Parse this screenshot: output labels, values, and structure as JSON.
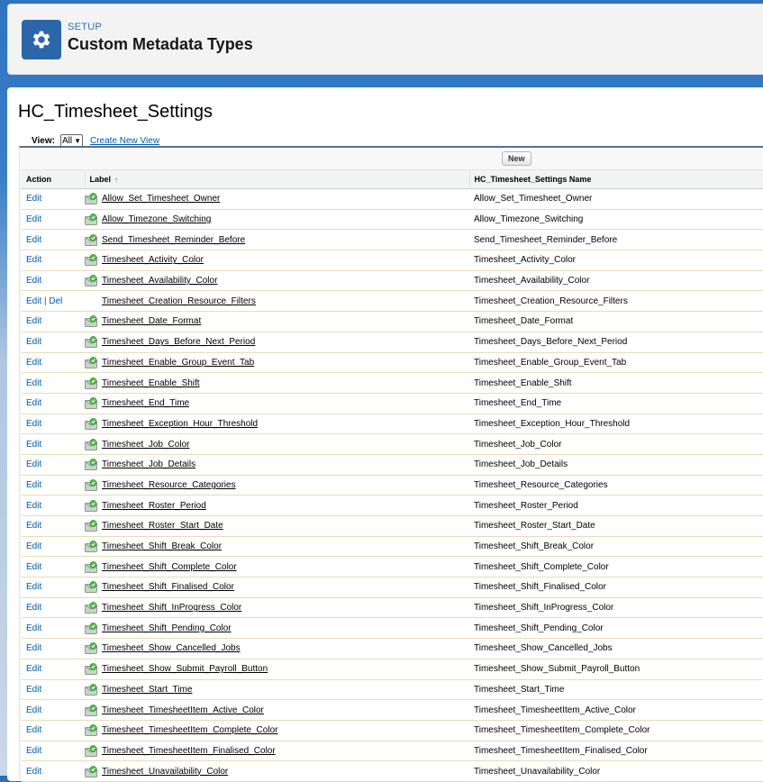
{
  "header": {
    "setup_label": "SETUP",
    "title": "Custom Metadata Types",
    "icon": "gear-icon"
  },
  "main": {
    "object_title": "HC_Timesheet_Settings",
    "view_label": "View:",
    "view_selected": "All",
    "create_view_link": "Create New View",
    "new_button": "New"
  },
  "table": {
    "columns": {
      "action": "Action",
      "label": "Label",
      "label_sort": "↑",
      "name": "HC_Timesheet_Settings Name"
    },
    "rows": [
      {
        "action": "Edit",
        "managed": true,
        "label": "Allow_Set_Timesheet_Owner",
        "name": "Allow_Set_Timesheet_Owner"
      },
      {
        "action": "Edit",
        "managed": true,
        "label": "Allow_Timezone_Switching",
        "name": "Allow_Timezone_Switching"
      },
      {
        "action": "Edit",
        "managed": true,
        "label": "Send_Timesheet_Reminder_Before",
        "name": "Send_Timesheet_Reminder_Before"
      },
      {
        "action": "Edit",
        "managed": true,
        "label": "Timesheet_Activity_Color",
        "name": "Timesheet_Activity_Color"
      },
      {
        "action": "Edit",
        "managed": true,
        "label": "Timesheet_Availability_Color",
        "name": "Timesheet_Availability_Color"
      },
      {
        "action": "Edit | Del",
        "managed": false,
        "label": "Timesheet_Creation_Resource_Filters",
        "name": "Timesheet_Creation_Resource_Filters"
      },
      {
        "action": "Edit",
        "managed": true,
        "label": "Timesheet_Date_Format",
        "name": "Timesheet_Date_Format"
      },
      {
        "action": "Edit",
        "managed": true,
        "label": "Timesheet_Days_Before_Next_Period",
        "name": "Timesheet_Days_Before_Next_Period"
      },
      {
        "action": "Edit",
        "managed": true,
        "label": "Timesheet_Enable_Group_Event_Tab",
        "name": "Timesheet_Enable_Group_Event_Tab"
      },
      {
        "action": "Edit",
        "managed": true,
        "label": "Timesheet_Enable_Shift",
        "name": "Timesheet_Enable_Shift"
      },
      {
        "action": "Edit",
        "managed": true,
        "label": "Timesheet_End_Time",
        "name": "Timesheet_End_Time"
      },
      {
        "action": "Edit",
        "managed": true,
        "label": "Timesheet_Exception_Hour_Threshold",
        "name": "Timesheet_Exception_Hour_Threshold"
      },
      {
        "action": "Edit",
        "managed": true,
        "label": "Timesheet_Job_Color",
        "name": "Timesheet_Job_Color"
      },
      {
        "action": "Edit",
        "managed": true,
        "label": "Timesheet_Job_Details",
        "name": "Timesheet_Job_Details"
      },
      {
        "action": "Edit",
        "managed": true,
        "label": "Timesheet_Resource_Categories",
        "name": "Timesheet_Resource_Categories"
      },
      {
        "action": "Edit",
        "managed": true,
        "label": "Timesheet_Roster_Period",
        "name": "Timesheet_Roster_Period"
      },
      {
        "action": "Edit",
        "managed": true,
        "label": "Timesheet_Roster_Start_Date",
        "name": "Timesheet_Roster_Start_Date"
      },
      {
        "action": "Edit",
        "managed": true,
        "label": "Timesheet_Shift_Break_Color",
        "name": "Timesheet_Shift_Break_Color"
      },
      {
        "action": "Edit",
        "managed": true,
        "label": "Timesheet_Shift_Complete_Color",
        "name": "Timesheet_Shift_Complete_Color"
      },
      {
        "action": "Edit",
        "managed": true,
        "label": "Timesheet_Shift_Finalised_Color",
        "name": "Timesheet_Shift_Finalised_Color"
      },
      {
        "action": "Edit",
        "managed": true,
        "label": "Timesheet_Shift_InProgress_Color",
        "name": "Timesheet_Shift_InProgress_Color"
      },
      {
        "action": "Edit",
        "managed": true,
        "label": "Timesheet_Shift_Pending_Color",
        "name": "Timesheet_Shift_Pending_Color"
      },
      {
        "action": "Edit",
        "managed": true,
        "label": "Timesheet_Show_Cancelled_Jobs",
        "name": "Timesheet_Show_Cancelled_Jobs"
      },
      {
        "action": "Edit",
        "managed": true,
        "label": "Timesheet_Show_Submit_Payroll_Button",
        "name": "Timesheet_Show_Submit_Payroll_Button"
      },
      {
        "action": "Edit",
        "managed": true,
        "label": "Timesheet_Start_Time",
        "name": "Timesheet_Start_Time"
      },
      {
        "action": "Edit",
        "managed": true,
        "label": "Timesheet_TimesheetItem_Active_Color",
        "name": "Timesheet_TimesheetItem_Active_Color"
      },
      {
        "action": "Edit",
        "managed": true,
        "label": "Timesheet_TimesheetItem_Complete_Color",
        "name": "Timesheet_TimesheetItem_Complete_Color"
      },
      {
        "action": "Edit",
        "managed": true,
        "label": "Timesheet_TimesheetItem_Finalised_Color",
        "name": "Timesheet_TimesheetItem_Finalised_Color"
      },
      {
        "action": "Edit",
        "managed": true,
        "label": "Timesheet_Unavailability_Color",
        "name": "Timesheet_Unavailability_Color"
      }
    ]
  },
  "colors": {
    "brand": "#2b67a8",
    "link": "#015ba7",
    "setup_label": "#2f6fb1"
  }
}
